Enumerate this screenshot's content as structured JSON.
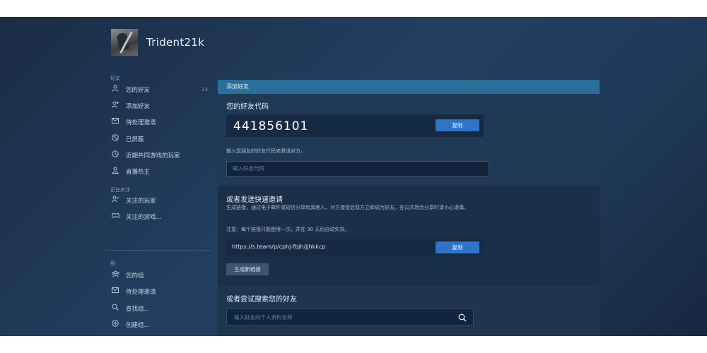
{
  "profile": {
    "username": "Trident21k"
  },
  "sidebar": {
    "friends_label": "好友",
    "friends_items": [
      {
        "label": "您的好友",
        "icon": "person-icon",
        "count": "23"
      },
      {
        "label": "添加好友",
        "icon": "add-person-icon"
      },
      {
        "label": "待处理邀请",
        "icon": "envelope-icon"
      },
      {
        "label": "已屏蔽",
        "icon": "blocked-icon"
      },
      {
        "label": "近期共同游戏的玩家",
        "icon": "clock-icon"
      },
      {
        "label": "直播热主",
        "icon": "broadcast-person-icon"
      }
    ],
    "following_label": "正在关注",
    "following_items": [
      {
        "label": "关注的玩家",
        "icon": "follow-person-icon"
      },
      {
        "label": "关注的游戏...",
        "icon": "gamepad-icon"
      }
    ],
    "groups_label": "组",
    "groups_items": [
      {
        "label": "您的组",
        "icon": "group-icon"
      },
      {
        "label": "待处理邀请",
        "icon": "envelope-icon"
      },
      {
        "label": "查找组...",
        "icon": "search-icon"
      },
      {
        "label": "创建组...",
        "icon": "plus-circle-icon"
      }
    ]
  },
  "panel": {
    "header": "添加好友",
    "code_section": {
      "title": "您的好友代码",
      "code": "441856101",
      "copy_label": "复制",
      "hint": "输入您朋友的好友代码来邀请对方。",
      "input_placeholder": "输入好友代码"
    },
    "invite_section": {
      "title": "或者发送快速邀请",
      "description": "生成链接，通过电子邮件或短信分享给其他人。对方接受后双方立即成为好友。在公共场合分享时请小心谨慎。",
      "note": "注意：每个链接只能使用一次，并在 30 天后自动失效。",
      "link": "https://s.team/p/cphj-fbjh/jjhkkcp",
      "copy_label": "复制",
      "new_link_label": "生成新链接"
    },
    "search_section": {
      "title": "或者尝试搜索您的好友",
      "placeholder": "输入好友的个人资料名称"
    }
  }
}
